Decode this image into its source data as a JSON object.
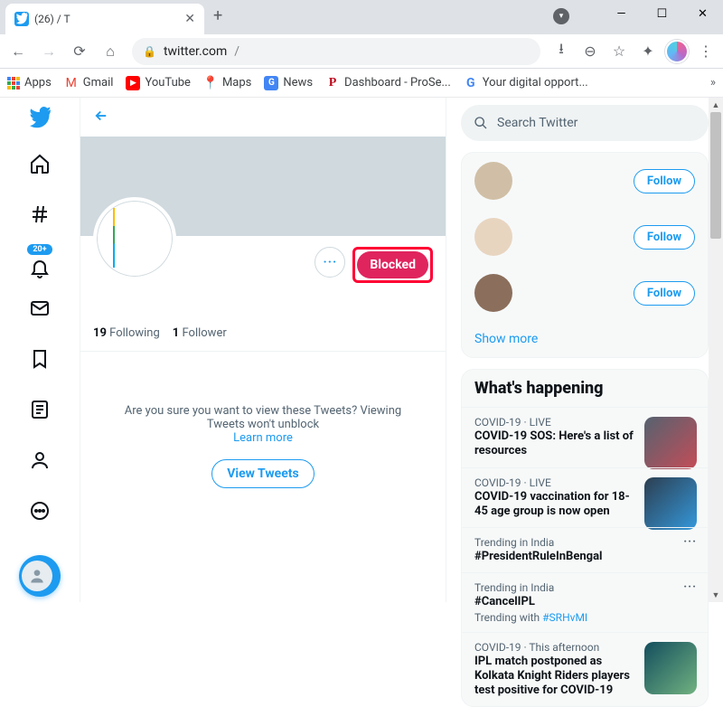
{
  "browser": {
    "tab_title": "(26)                             / T",
    "url_host": "twitter.com",
    "url_path": "/",
    "bookmarks": {
      "apps": "Apps",
      "gmail": "Gmail",
      "youtube": "YouTube",
      "maps": "Maps",
      "news": "News",
      "dashboard": "Dashboard - ProSe...",
      "digital": "Your digital opport..."
    }
  },
  "leftnav": {
    "notif_badge": "20+"
  },
  "profile": {
    "blocked_label": "Blocked",
    "following_count": "19",
    "following_label": "Following",
    "followers_count": "1",
    "followers_label": "Follower",
    "confirm_line1": "Are you sure you want to view these Tweets? Viewing Tweets won't unblock",
    "learn_more": "Learn more",
    "view_tweets": "View Tweets"
  },
  "search": {
    "placeholder": "Search Twitter"
  },
  "who": {
    "follow_label": "Follow",
    "show_more": "Show more"
  },
  "happening": {
    "heading": "What's happening",
    "items": [
      {
        "cat": "COVID-19 · LIVE",
        "title": "COVID-19 SOS: Here's a list of resources",
        "sub": "",
        "img": true,
        "more": false
      },
      {
        "cat": "COVID-19 · LIVE",
        "title": "COVID-19 vaccination for 18-45 age group is now open",
        "sub": "",
        "img": true,
        "more": false
      },
      {
        "cat": "Trending in India",
        "title": "#PresidentRuleInBengal",
        "sub": "",
        "img": false,
        "more": true
      },
      {
        "cat": "Trending in India",
        "title": "#CancelIPL",
        "sub": "Trending with",
        "sublink": "#SRHvMI",
        "img": false,
        "more": true
      },
      {
        "cat": "COVID-19 · This afternoon",
        "title": "IPL match postponed as Kolkata Knight Riders players test positive for COVID-19",
        "sub": "",
        "img": true,
        "more": false
      }
    ]
  }
}
